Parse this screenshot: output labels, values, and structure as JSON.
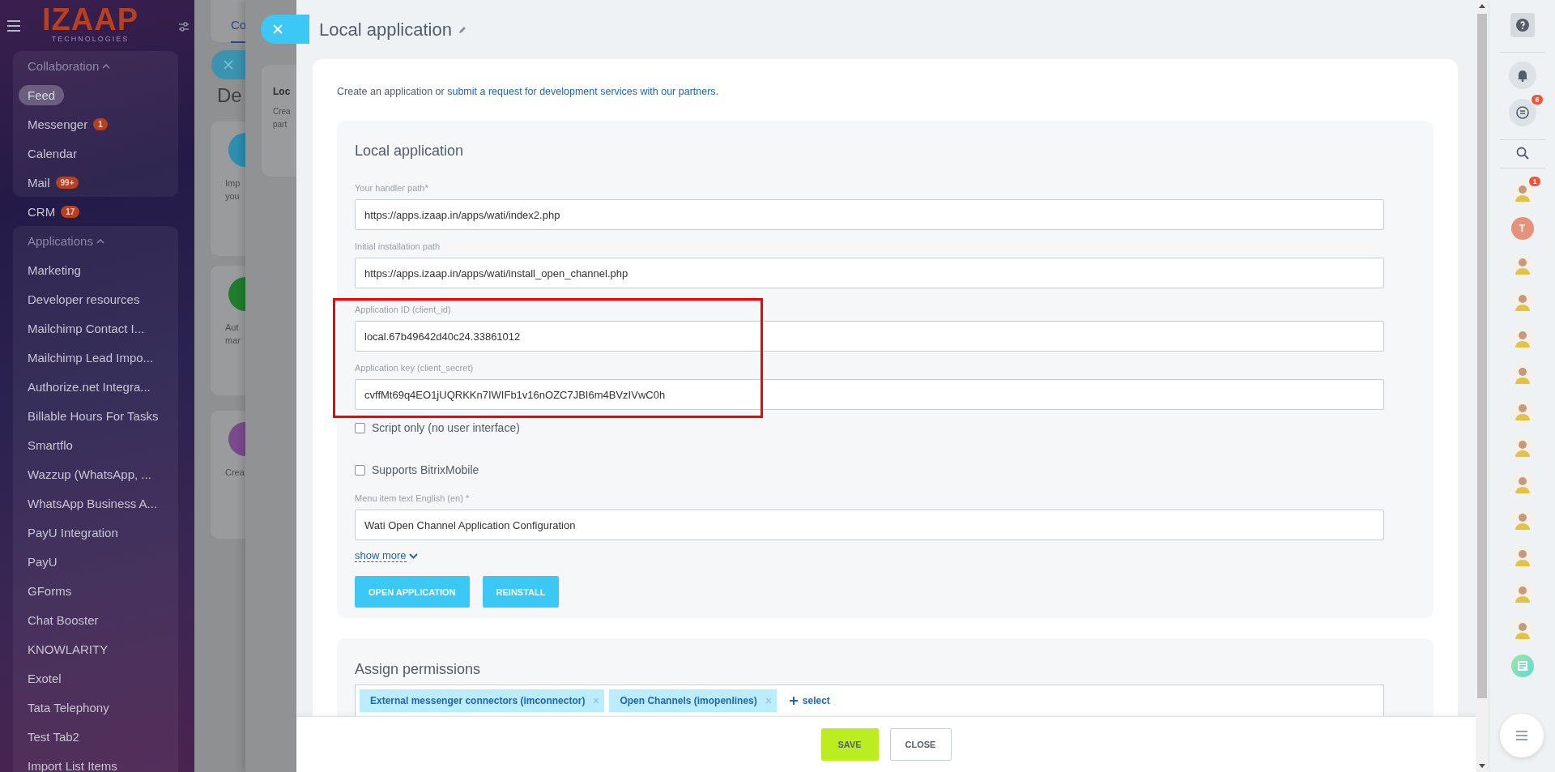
{
  "sidebar": {
    "logo": {
      "name": "IZAAP",
      "tagline": "TECHNOLOGIES"
    },
    "sections": [
      {
        "kind": "group",
        "title": "Collaboration",
        "expanded": true,
        "items": [
          {
            "label": "Feed",
            "selected": true
          },
          {
            "label": "Messenger",
            "badge": "1",
            "selected": false
          },
          {
            "label": "Calendar",
            "selected": false
          },
          {
            "label": "Mail",
            "badge": "99+",
            "selected": false
          }
        ]
      },
      {
        "kind": "item",
        "label": "CRM",
        "badge": "17",
        "selected": false
      },
      {
        "kind": "group",
        "title": "Applications",
        "expanded": true,
        "items": [
          {
            "label": "Marketing",
            "selected": false
          },
          {
            "label": "Developer resources",
            "selected": false
          },
          {
            "label": "Mailchimp Contact I...",
            "selected": false
          },
          {
            "label": "Mailchimp Lead Impo...",
            "selected": false
          },
          {
            "label": "Authorize.net Integra...",
            "selected": false
          },
          {
            "label": "Billable Hours For Tasks",
            "selected": false
          },
          {
            "label": "Smartflo",
            "selected": false
          },
          {
            "label": "Wazzup (WhatsApp, ...",
            "selected": false
          },
          {
            "label": "WhatsApp Business A...",
            "selected": false
          },
          {
            "label": "PayU Integration",
            "selected": false
          },
          {
            "label": "PayU",
            "selected": false
          },
          {
            "label": "GForms",
            "selected": false
          },
          {
            "label": "Chat Booster",
            "selected": false
          },
          {
            "label": "KNOWLARITY",
            "selected": false
          },
          {
            "label": "Exotel",
            "selected": false
          },
          {
            "label": "Tata Telephony",
            "selected": false
          },
          {
            "label": "Test Tab2",
            "selected": false
          },
          {
            "label": "Import List Items",
            "selected": false
          }
        ]
      }
    ]
  },
  "background": {
    "tab": "Co",
    "heading": "De",
    "cards": [
      {
        "color": "#2b8fb0",
        "lines": [
          "Imp",
          "you"
        ]
      },
      {
        "color": "#1f7d2e",
        "lines": [
          "Aut",
          "mar"
        ]
      },
      {
        "color": "#7a4a8c",
        "lines": [
          "Crea"
        ]
      }
    ],
    "panel": {
      "title": "Loc",
      "lines": [
        "Crea",
        "part"
      ]
    }
  },
  "slider": {
    "title": "Local application",
    "intro": {
      "text": "Create an application or",
      "link": "submit a request for development services with our partners."
    },
    "section": {
      "title": "Local application",
      "fields": [
        {
          "label": "Your handler path*",
          "value": "https://apps.izaap.in/apps/wati/index2.php"
        },
        {
          "label": "Initial installation path",
          "value": "https://apps.izaap.in/apps/wati/install_open_channel.php"
        },
        {
          "label": "Application ID (client_id)",
          "value": "local.67b49642d40c24.33861012"
        },
        {
          "label": "Application key (client_secret)",
          "value": "cvffMt69q4EO1jUQRKKn7IWIFb1v16nOZC7JBI6m4BVzIVwC0h"
        }
      ],
      "checkboxes": [
        {
          "label": "Script only (no user interface)",
          "checked": false
        },
        {
          "label": "Supports BitrixMobile",
          "checked": false
        }
      ],
      "menu_field": {
        "label": "Menu item text English (en) *",
        "value": "Wati Open Channel Application Configuration"
      },
      "show_more": "show more",
      "buttons": [
        "OPEN APPLICATION",
        "REINSTALL"
      ]
    },
    "permissions": {
      "title": "Assign permissions",
      "tags": [
        "External messenger connectors (imconnector)",
        "Open Channels (imopenlines)"
      ],
      "add": "select"
    },
    "footer": {
      "buttons": [
        {
          "label": "SAVE",
          "kind": "primary"
        },
        {
          "label": "CLOSE",
          "kind": "secondary"
        }
      ]
    }
  },
  "right_bar": {
    "chat_badge": "6",
    "contacts": [
      {
        "kind": "photo",
        "badge": "1"
      },
      {
        "kind": "letter",
        "text": "T",
        "color": "#e5927b"
      },
      {
        "kind": "photo"
      },
      {
        "kind": "photo"
      },
      {
        "kind": "photo"
      },
      {
        "kind": "photo"
      },
      {
        "kind": "photo"
      },
      {
        "kind": "photo"
      },
      {
        "kind": "photo"
      },
      {
        "kind": "photo"
      },
      {
        "kind": "photo"
      },
      {
        "kind": "photo"
      },
      {
        "kind": "photo"
      },
      {
        "kind": "app"
      }
    ]
  }
}
